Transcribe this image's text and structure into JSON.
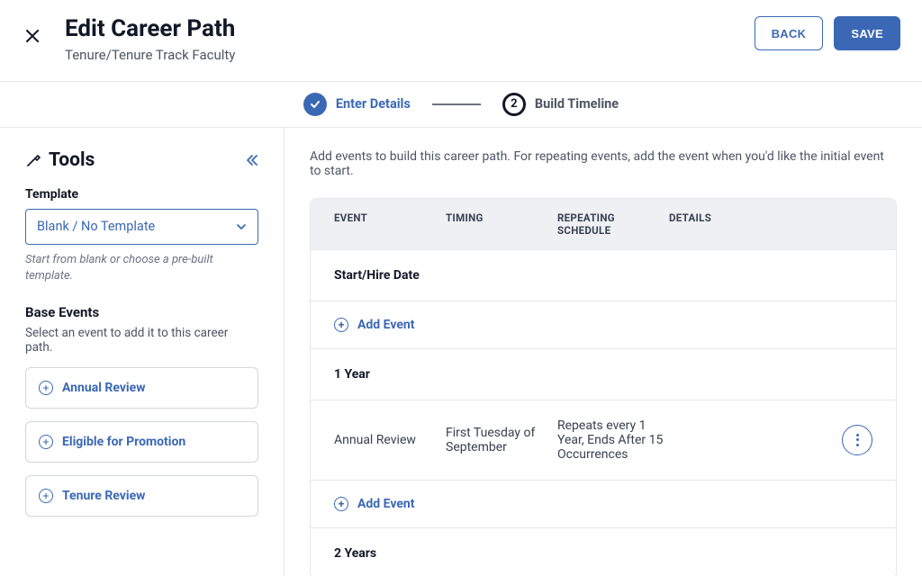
{
  "header": {
    "title": "Edit Career Path",
    "subtitle": "Tenure/Tenure Track Faculty",
    "back_label": "BACK",
    "save_label": "SAVE"
  },
  "stepper": {
    "step1_label": "Enter Details",
    "step2_label": "Build Timeline",
    "step2_number": "2"
  },
  "sidebar": {
    "tools_title": "Tools",
    "template_label": "Template",
    "template_value": "Blank / No Template",
    "template_hint": "Start from blank or choose a pre-built template.",
    "base_events_label": "Base Events",
    "base_events_hint": "Select an event to add it to this career path.",
    "events": [
      {
        "label": "Annual Review"
      },
      {
        "label": "Eligible for Promotion"
      },
      {
        "label": "Tenure Review"
      }
    ]
  },
  "main": {
    "instructions": "Add events to build this career path. For repeating events, add the event when you'd like the initial event to start.",
    "columns": {
      "event": "EVENT",
      "timing": "TIMING",
      "schedule": "REPEATING SCHEDULE",
      "details": "DETAILS"
    },
    "add_event_label": "Add Event",
    "sections": [
      {
        "label": "Start/Hire Date",
        "rows": []
      },
      {
        "label": "1 Year",
        "rows": [
          {
            "event": "Annual Review",
            "timing": "First Tuesday of September",
            "schedule": "Repeats every 1 Year, Ends After 15 Occurrences",
            "details": ""
          }
        ]
      },
      {
        "label": "2 Years",
        "rows": []
      }
    ]
  }
}
